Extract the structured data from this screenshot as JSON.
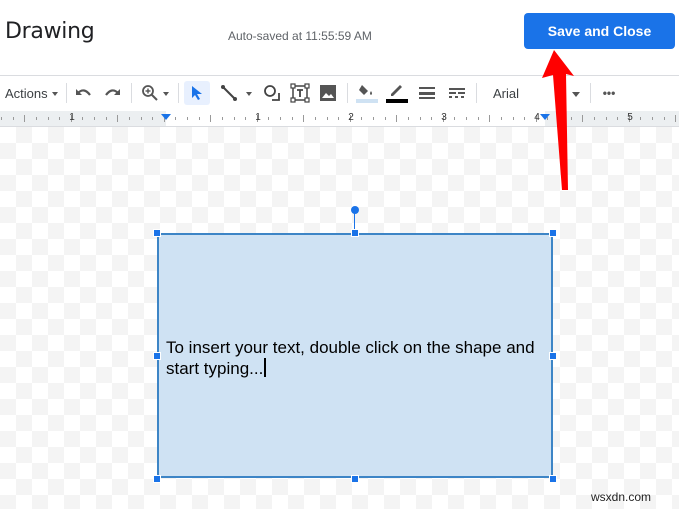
{
  "header": {
    "title": "Drawing",
    "autosave_status": "Auto-saved at 11:55:59 AM",
    "save_close_label": "Save and Close"
  },
  "toolbar": {
    "actions_label": "Actions",
    "font_name": "Arial",
    "items": [
      "undo-icon",
      "redo-icon",
      "zoom-icon",
      "select-icon",
      "line-icon",
      "shape-icon",
      "text-box-icon",
      "image-icon",
      "fill-color-icon",
      "border-color-icon",
      "border-weight-icon",
      "border-dash-icon",
      "more-icon"
    ],
    "fill_color": "#cfe2f3",
    "border_color": "#000000",
    "more_label": "•••"
  },
  "ruler": {
    "labels": [
      "1",
      "1",
      "2",
      "3",
      "4",
      "5"
    ]
  },
  "canvas": {
    "shape_text": "To insert your text, double click on the shape and start typing...",
    "shape_fill": "#cfe2f3",
    "shape_border": "#3d85c6"
  },
  "annotation": {
    "arrow_color": "#ff0000",
    "points_to": "Save and Close"
  },
  "watermark": "wsxdn.com"
}
